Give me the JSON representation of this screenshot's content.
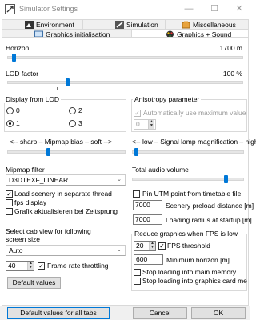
{
  "window": {
    "title": "Simulator Settings",
    "minimize": "—",
    "maximize": "☐",
    "close": "✕"
  },
  "tabs_row1": [
    {
      "label": "Environment",
      "icon": "environment-icon"
    },
    {
      "label": "Simulation",
      "icon": "simulation-icon"
    },
    {
      "label": "Miscellaneous",
      "icon": "miscellaneous-icon"
    }
  ],
  "tabs_row2": [
    {
      "label": "Graphics initialisation",
      "icon": "graphics-init-icon"
    },
    {
      "label": "Graphics + Sound",
      "icon": "graphics-sound-icon",
      "active": true
    }
  ],
  "horizon": {
    "label": "Horizon",
    "value": "1700 m",
    "level": 0.02
  },
  "lod_factor": {
    "label": "LOD factor",
    "value": "100 %",
    "level": 0.25
  },
  "display_from_lod": {
    "title": "Display from LOD",
    "options": [
      {
        "label": "0",
        "selected": false
      },
      {
        "label": "2",
        "selected": false
      },
      {
        "label": "1",
        "selected": true
      },
      {
        "label": "3",
        "selected": false
      }
    ]
  },
  "anisotropy": {
    "title": "Anisotropy parameter",
    "auto_label": "Automatically use maximum value",
    "auto_checked": true,
    "value": "0"
  },
  "mipmap_bias": {
    "label": "<-- sharp  – Mipmap bias –  soft -->",
    "level": 0.34
  },
  "signal_lamp": {
    "label": "<-- low – Signal lamp magnification – high",
    "level": 0.02
  },
  "mipmap_filter": {
    "label": "Mipmap filter",
    "selected": "D3DTEXF_LINEAR"
  },
  "total_audio_volume": {
    "label": "Total audio volume",
    "level": 0.85
  },
  "checks_left": [
    {
      "label": "Load scenery in separate thread",
      "checked": true
    },
    {
      "label": "fps display",
      "checked": false
    },
    {
      "label": "Grafik aktualisieren bei Zeitsprung",
      "checked": false
    }
  ],
  "pin_utm": {
    "label": "Pin UTM point from timetable file",
    "checked": false
  },
  "scenery_preload": {
    "value": "7000",
    "label": "Scenery preload distance [m]"
  },
  "loading_radius": {
    "value": "7000",
    "label": "Loading radius at startup [m]"
  },
  "cab_view": {
    "label_line1": "Select cab view for following",
    "label_line2": "screen size",
    "selected": "Auto"
  },
  "frame_rate": {
    "value": "40",
    "label": "Frame rate throttling",
    "checked": true
  },
  "default_values_button": "Default values",
  "reduce_graphics": {
    "title": "Reduce graphics when FPS is low",
    "fps_value": "20",
    "fps_label": "FPS threshold",
    "fps_checked": true,
    "horizon_value": "600",
    "horizon_label": "Minimum horizon [m]",
    "stop_main": "Stop loading into main memory",
    "stop_graphics": "Stop loading into graphics card me"
  },
  "footer": {
    "default_all": "Default values for all tabs",
    "cancel": "Cancel",
    "ok": "OK"
  },
  "colors": {
    "accent": "#0078d7",
    "border": "#d9d9d9",
    "button_bg": "#e1e1e1",
    "footer_bg": "#f0f0f0"
  }
}
